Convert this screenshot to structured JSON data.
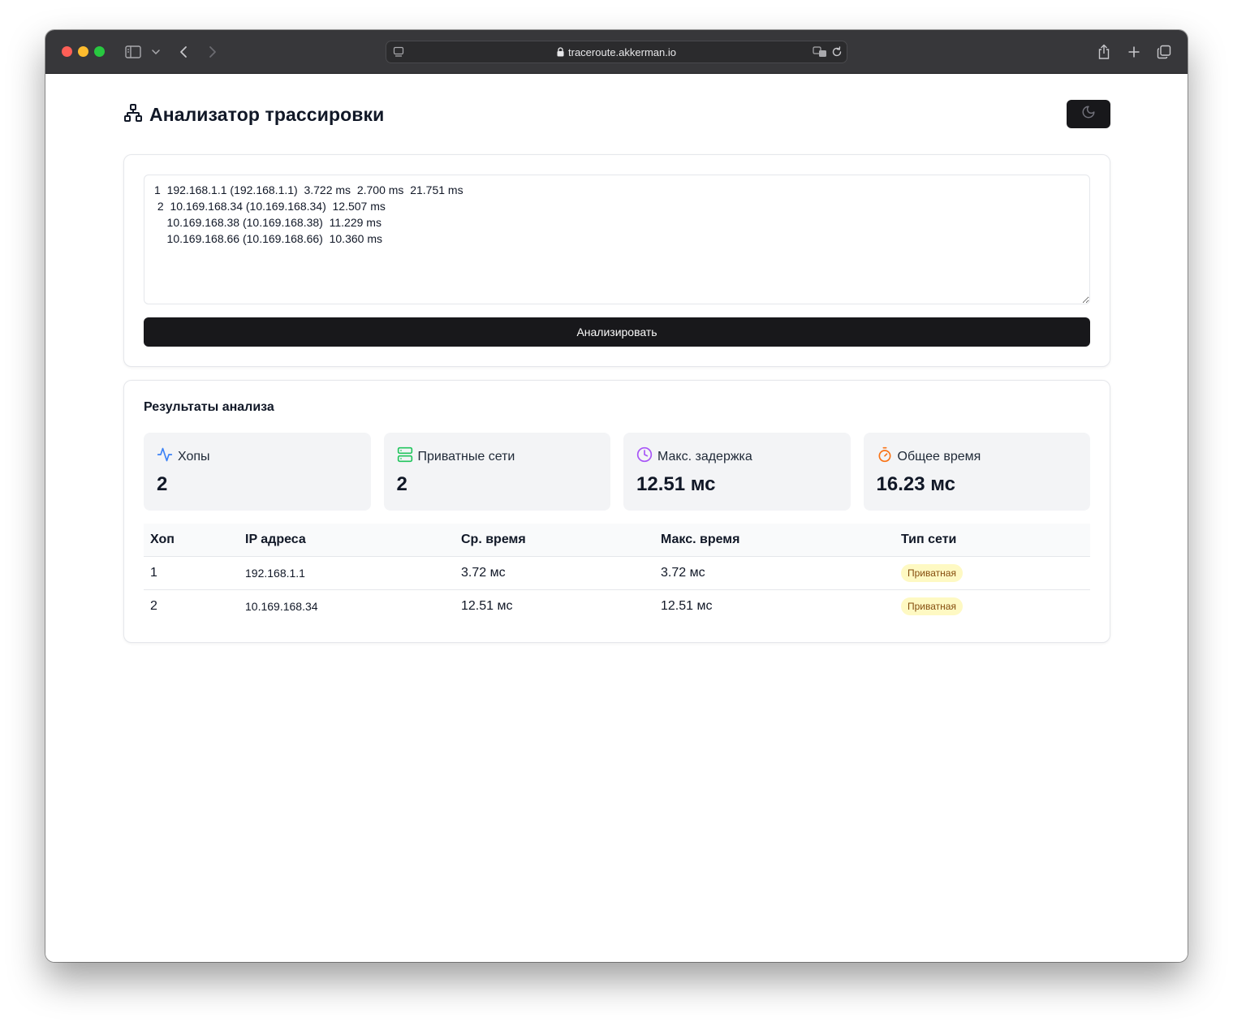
{
  "browser": {
    "url": "traceroute.akkerman.io"
  },
  "page": {
    "title": "Анализатор трассировки"
  },
  "input": {
    "trace_text": "1  192.168.1.1 (192.168.1.1)  3.722 ms  2.700 ms  21.751 ms\n 2  10.169.168.34 (10.169.168.34)  12.507 ms\n    10.169.168.38 (10.169.168.38)  11.229 ms\n    10.169.168.66 (10.169.168.66)  10.360 ms",
    "analyze_label": "Анализировать"
  },
  "results": {
    "title": "Результаты анализа",
    "stats": [
      {
        "label": "Хопы",
        "value": "2",
        "icon": "activity-icon",
        "color": "#3b82f6"
      },
      {
        "label": "Приватные сети",
        "value": "2",
        "icon": "server-icon",
        "color": "#22c55e"
      },
      {
        "label": "Макс. задержка",
        "value": "12.51 мс",
        "icon": "clock-icon",
        "color": "#a855f7"
      },
      {
        "label": "Общее время",
        "value": "16.23 мс",
        "icon": "timer-icon",
        "color": "#f97316"
      }
    ],
    "table": {
      "headers": [
        "Хоп",
        "IP адреса",
        "Ср. время",
        "Макс. время",
        "Тип сети"
      ],
      "rows": [
        {
          "hop": "1",
          "ip": "192.168.1.1",
          "avg": "3.72 мс",
          "max": "3.72 мс",
          "type": "Приватная"
        },
        {
          "hop": "2",
          "ip": "10.169.168.34",
          "avg": "12.51 мс",
          "max": "12.51 мс",
          "type": "Приватная"
        }
      ]
    }
  },
  "colors": {
    "primary_button": "#18181b",
    "badge_bg": "#fef9c3",
    "badge_text": "#854d0e"
  }
}
